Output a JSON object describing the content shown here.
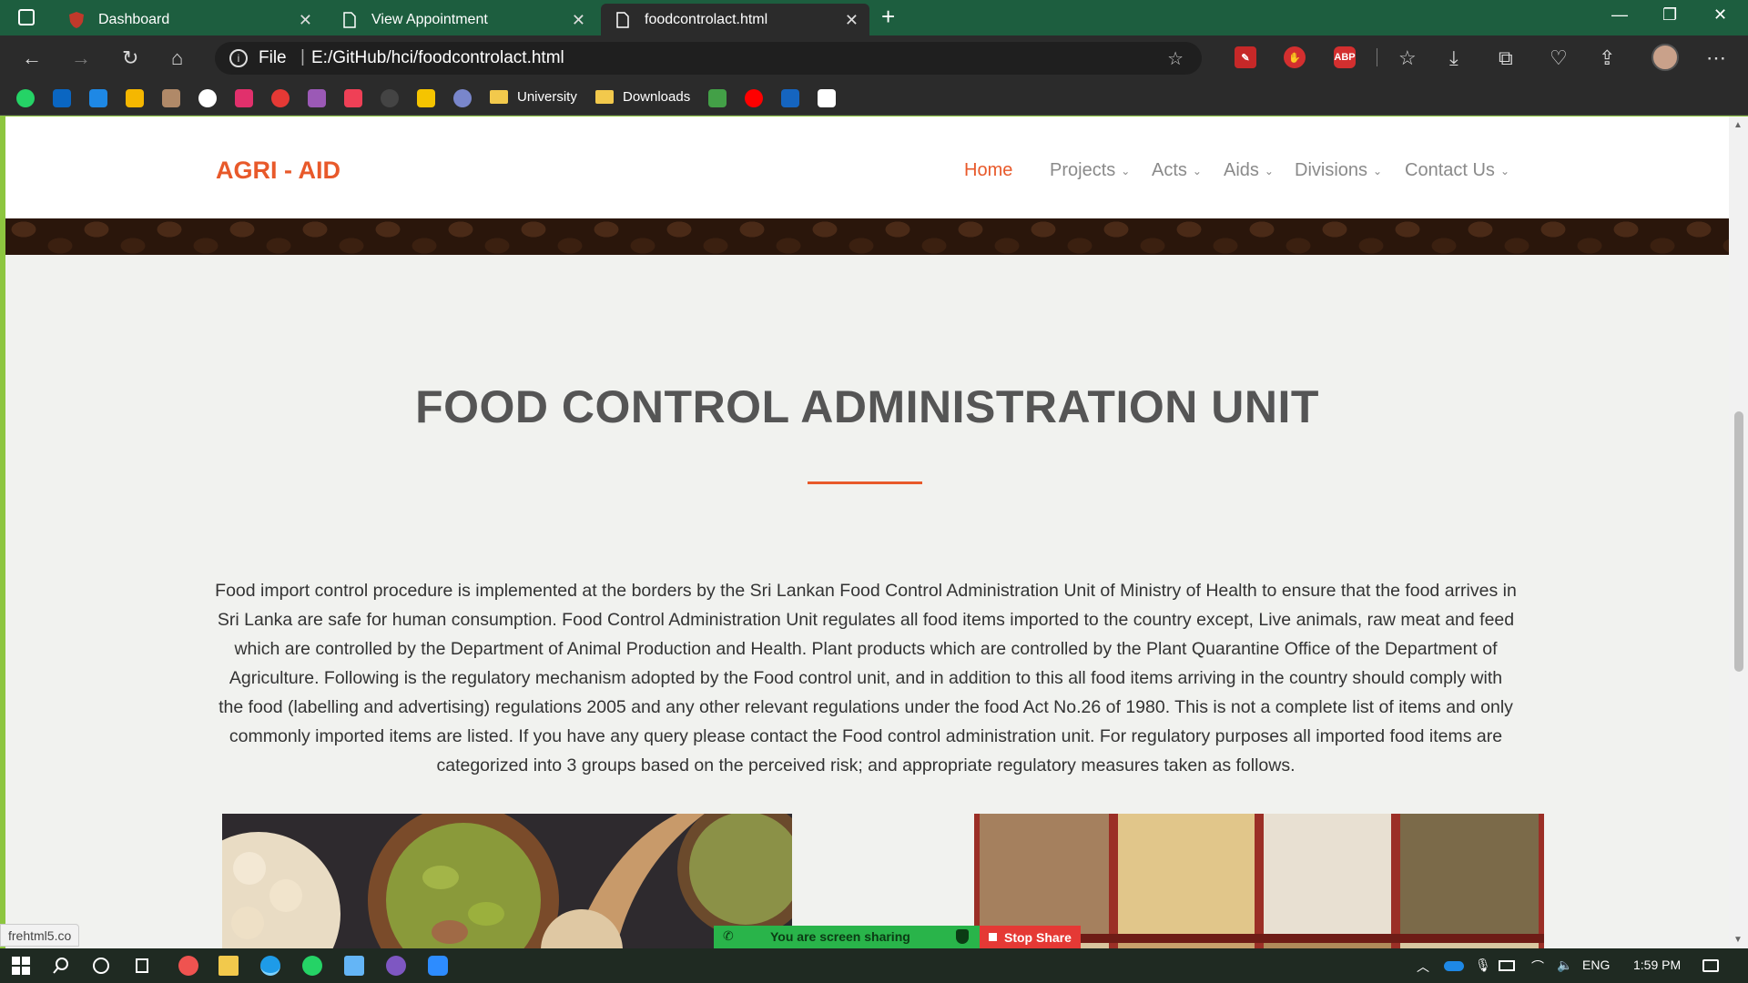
{
  "browser": {
    "tabs": [
      {
        "title": "Dashboard",
        "active": false
      },
      {
        "title": "View Appointment",
        "active": false
      },
      {
        "title": "foodcontrolact.html",
        "active": true
      }
    ],
    "new_tab_label": "+",
    "address": {
      "scheme_label": "File",
      "url": "E:/GitHub/hci/foodcontrolact.html"
    },
    "extensions": [
      "ABP"
    ],
    "bookmarks": [
      {
        "label": "University"
      },
      {
        "label": "Downloads"
      }
    ]
  },
  "site": {
    "brand": "AGRI - AID",
    "nav": [
      {
        "label": "Home",
        "active": true,
        "dropdown": false
      },
      {
        "label": "Projects",
        "active": false,
        "dropdown": true
      },
      {
        "label": "Acts",
        "active": false,
        "dropdown": true
      },
      {
        "label": "Aids",
        "active": false,
        "dropdown": true
      },
      {
        "label": "Divisions",
        "active": false,
        "dropdown": true
      },
      {
        "label": "Contact Us",
        "active": false,
        "dropdown": true
      }
    ],
    "heading": "FOOD CONTROL ADMINISTRATION UNIT",
    "body": "Food import control procedure is implemented at the borders by the Sri Lankan Food Control Administration Unit of Ministry of Health to ensure that the food arrives in Sri Lanka are safe for human consumption. Food Control Administration Unit regulates all food items imported to the country except, Live animals, raw meat and feed which are controlled by the Department of Animal Production and Health. Plant products which are controlled by the Plant Quarantine Office of the Department of Agriculture. Following is the regulatory mechanism adopted by the Food control unit, and in addition to this all food items arriving in the country should comply with the food (labelling and advertising) regulations 2005 and any other relevant regulations under the food Act No.26 of 1980. This is not a complete list of items and only commonly imported items are listed. If you have any query please contact the Food control administration unit. For regulatory purposes all imported food items are categorized into 3 groups based on the perceived risk; and appropriate regulatory measures taken as follows."
  },
  "status_url": "frehtml5.co",
  "screen_share": {
    "message": "You are screen sharing",
    "stop_label": "Stop Share"
  },
  "taskbar": {
    "language": "ENG",
    "time": "1:59 PM"
  },
  "colors": {
    "accent": "#e8592a",
    "chrome": "#2b2b2b",
    "tab_strip": "#1d5e3f",
    "frame": "#8dc63f"
  }
}
